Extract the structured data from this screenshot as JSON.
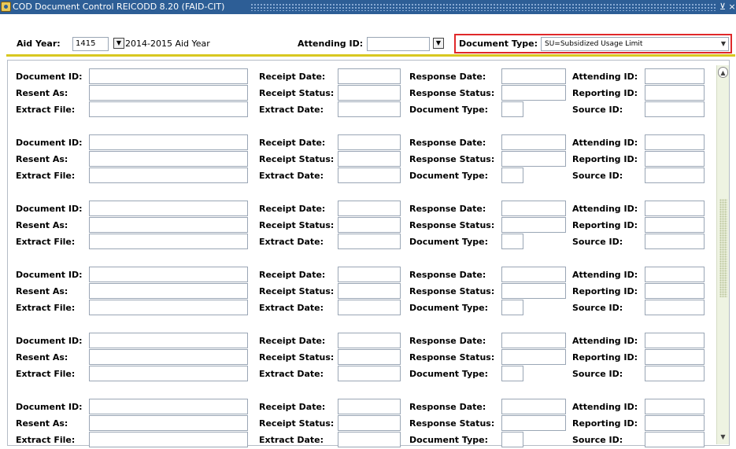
{
  "window": {
    "title": "COD Document Control  REICODD  8.20  (FAID-CIT)",
    "controls": [
      "⊻",
      "×"
    ]
  },
  "key_block": {
    "aid_year_label": "Aid Year:",
    "aid_year_value": "1415",
    "aid_year_desc": "2014-2015 Aid Year",
    "attending_id_label": "Attending ID:",
    "attending_id_value": "",
    "document_type_label": "Document Type:",
    "document_type_value": "SU=Subsidized Usage Limit",
    "dropdown_glyph": "▼"
  },
  "records": [
    {
      "document_id_label": "Document ID:",
      "resent_as_label": "Resent As:",
      "extract_file_label": "Extract File:",
      "receipt_date_label": "Receipt Date:",
      "receipt_status_label": "Receipt Status:",
      "extract_date_label": "Extract Date:",
      "response_date_label": "Response Date:",
      "response_status_label": "Response Status:",
      "document_type_label": "Document Type:",
      "attending_id_label": "Attending ID:",
      "reporting_id_label": "Reporting ID:",
      "source_id_label": "Source ID:"
    },
    {
      "document_id_label": "Document ID:",
      "resent_as_label": "Resent As:",
      "extract_file_label": "Extract File:",
      "receipt_date_label": "Receipt Date:",
      "receipt_status_label": "Receipt Status:",
      "extract_date_label": "Extract Date:",
      "response_date_label": "Response Date:",
      "response_status_label": "Response Status:",
      "document_type_label": "Document Type:",
      "attending_id_label": "Attending ID:",
      "reporting_id_label": "Reporting ID:",
      "source_id_label": "Source ID:"
    },
    {
      "document_id_label": "Document ID:",
      "resent_as_label": "Resent As:",
      "extract_file_label": "Extract File:",
      "receipt_date_label": "Receipt Date:",
      "receipt_status_label": "Receipt Status:",
      "extract_date_label": "Extract Date:",
      "response_date_label": "Response Date:",
      "response_status_label": "Response Status:",
      "document_type_label": "Document Type:",
      "attending_id_label": "Attending ID:",
      "reporting_id_label": "Reporting ID:",
      "source_id_label": "Source ID:"
    },
    {
      "document_id_label": "Document ID:",
      "resent_as_label": "Resent As:",
      "extract_file_label": "Extract File:",
      "receipt_date_label": "Receipt Date:",
      "receipt_status_label": "Receipt Status:",
      "extract_date_label": "Extract Date:",
      "response_date_label": "Response Date:",
      "response_status_label": "Response Status:",
      "document_type_label": "Document Type:",
      "attending_id_label": "Attending ID:",
      "reporting_id_label": "Reporting ID:",
      "source_id_label": "Source ID:"
    },
    {
      "document_id_label": "Document ID:",
      "resent_as_label": "Resent As:",
      "extract_file_label": "Extract File:",
      "receipt_date_label": "Receipt Date:",
      "receipt_status_label": "Receipt Status:",
      "extract_date_label": "Extract Date:",
      "response_date_label": "Response Date:",
      "response_status_label": "Response Status:",
      "document_type_label": "Document Type:",
      "attending_id_label": "Attending ID:",
      "reporting_id_label": "Reporting ID:",
      "source_id_label": "Source ID:"
    },
    {
      "document_id_label": "Document ID:",
      "resent_as_label": "Resent As:",
      "extract_file_label": "Extract File:",
      "receipt_date_label": "Receipt Date:",
      "receipt_status_label": "Receipt Status:",
      "extract_date_label": "Extract Date:",
      "response_date_label": "Response Date:",
      "response_status_label": "Response Status:",
      "document_type_label": "Document Type:",
      "attending_id_label": "Attending ID:",
      "reporting_id_label": "Reporting ID:",
      "source_id_label": "Source ID:"
    }
  ],
  "scrollbar": {
    "up_glyph": "▲",
    "down_glyph": "▼"
  },
  "colors": {
    "titlebar": "#2d5e96",
    "highlight_box": "#e0282a",
    "separator_bar": "#d8c820"
  }
}
